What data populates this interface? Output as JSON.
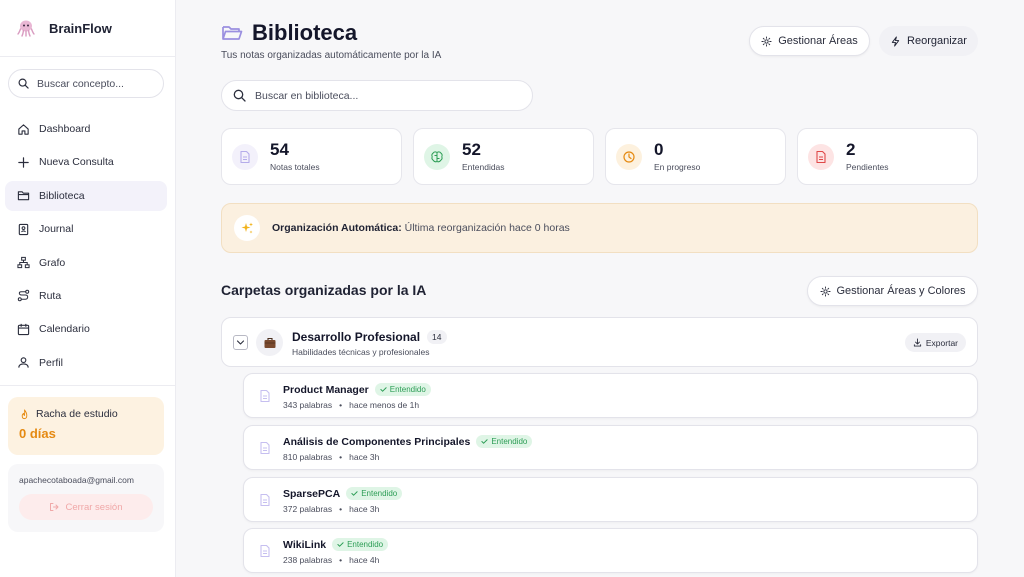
{
  "brand": {
    "name": "BrainFlow"
  },
  "sidebar": {
    "search_placeholder": "Buscar concepto...",
    "items": [
      {
        "label": "Dashboard",
        "icon": "home-icon"
      },
      {
        "label": "Nueva Consulta",
        "icon": "plus-icon"
      },
      {
        "label": "Biblioteca",
        "icon": "folder-icon",
        "active": true
      },
      {
        "label": "Journal",
        "icon": "journal-icon"
      },
      {
        "label": "Grafo",
        "icon": "graph-icon"
      },
      {
        "label": "Ruta",
        "icon": "route-icon"
      },
      {
        "label": "Calendario",
        "icon": "calendar-icon"
      },
      {
        "label": "Perfil",
        "icon": "user-icon"
      }
    ],
    "streak": {
      "title": "Racha de estudio",
      "days": "0 días"
    },
    "user": {
      "email": "apachecotaboada@gmail.com",
      "logout_label": "Cerrar sesión"
    }
  },
  "header": {
    "title": "Biblioteca",
    "subtitle": "Tus notas organizadas automáticamente por la IA",
    "manage_areas_label": "Gestionar Áreas",
    "reorganize_label": "Reorganizar",
    "search_placeholder": "Buscar en biblioteca..."
  },
  "stats": [
    {
      "value": "54",
      "label": "Notas totales",
      "icon": "document-icon",
      "color": "#8b7fd4"
    },
    {
      "value": "52",
      "label": "Entendidas",
      "icon": "brain-icon",
      "color": "#2c9d55"
    },
    {
      "value": "0",
      "label": "En progreso",
      "icon": "clock-icon",
      "color": "#e58a12"
    },
    {
      "value": "2",
      "label": "Pendientes",
      "icon": "file-alert-icon",
      "color": "#e04848"
    }
  ],
  "banner": {
    "bold": "Organización Automática:",
    "text": " Última reorganización hace 0 horas"
  },
  "section": {
    "title": "Carpetas organizadas por la IA",
    "manage_label": "Gestionar Áreas y Colores"
  },
  "folder": {
    "name": "Desarrollo Profesional",
    "count": "14",
    "description": "Habilidades técnicas y profesionales",
    "export_label": "Exportar"
  },
  "notes": [
    {
      "title": "Product Manager",
      "status": "Entendido",
      "words": "343 palabras",
      "time": "hace menos de 1h"
    },
    {
      "title": "Análisis de Componentes Principales",
      "status": "Entendido",
      "words": "810 palabras",
      "time": "hace 3h"
    },
    {
      "title": "SparsePCA",
      "status": "Entendido",
      "words": "372 palabras",
      "time": "hace 3h"
    },
    {
      "title": "WikiLink",
      "status": "Entendido",
      "words": "238 palabras",
      "time": "hace 4h"
    }
  ],
  "meta_separator": "•"
}
